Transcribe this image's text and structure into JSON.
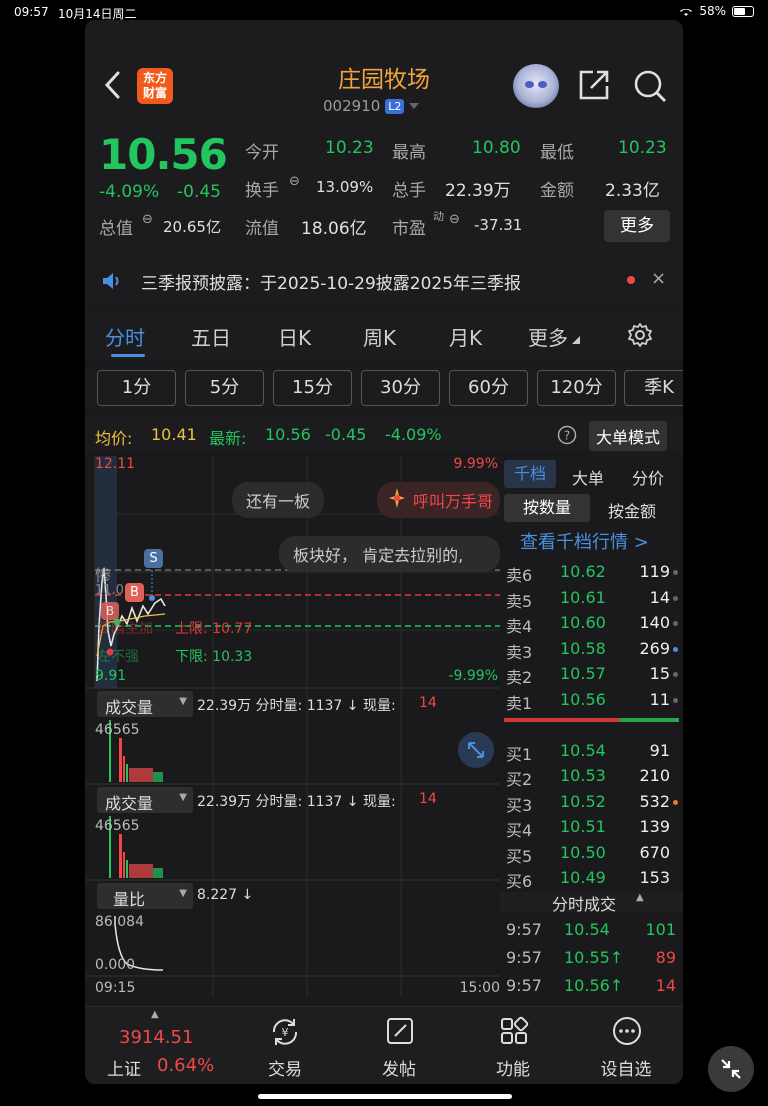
{
  "status": {
    "time": "09:57",
    "date": "10月14日周二",
    "battery": "58%"
  },
  "header": {
    "logo_text_1": "东方",
    "logo_text_2": "财富",
    "title": "庄园牧场",
    "code": "002910",
    "level_badge": "L2"
  },
  "quote": {
    "price": "10.56",
    "change_pct": "-4.09%",
    "change_abs": "-0.45",
    "open_label": "今开",
    "open": "10.23",
    "high_label": "最高",
    "high": "10.80",
    "low_label": "最低",
    "low": "10.23",
    "turnover_label": "换手",
    "turnover": "13.09%",
    "volume_label": "总手",
    "volume": "22.39万",
    "amount_label": "金额",
    "amount": "2.33亿",
    "mktcap_label": "总值",
    "mktcap": "20.65亿",
    "float_label": "流值",
    "float": "18.06亿",
    "pe_label": "市盈",
    "pe_sup": "动",
    "pe": "-37.31",
    "more_button": "更多"
  },
  "notice": {
    "text": "三季报预披露：于2025-10-29披露2025年三季报",
    "close": "×"
  },
  "tabs": [
    "分时",
    "五日",
    "日K",
    "周K",
    "月K",
    "更多"
  ],
  "intervals": [
    "1分",
    "5分",
    "15分",
    "30分",
    "60分",
    "120分",
    "季K"
  ],
  "avgbar": {
    "avg_label": "均价:",
    "avg": "10.41",
    "latest_label": "最新:",
    "latest": "10.56",
    "chg": "-0.45",
    "pct": "-4.09%",
    "mode_button": "大单模式"
  },
  "chart": {
    "upper_price": "12.11",
    "upper_pct": "9.99%",
    "lower_price": "9.91",
    "lower_pct": "-9.99%",
    "bubble1": "还有一板",
    "bubble2": "呼叫万手哥",
    "bubble3": "板块好， 肯定去拉别的,",
    "tag_left": "惨",
    "tag_s": "S",
    "tag_b": "B",
    "tag_b2": "B",
    "upper_limit": "上限: 10.77",
    "lower_limit": "下限: 10.33",
    "faded1": "要暗主加",
    "faded2": "左不强",
    "faded3": "11.0",
    "vol_label": "成交量",
    "vol_info": "22.39万 分时量: 1137 ↓ 现量:",
    "vol_now": "14",
    "vol_max": "46565",
    "ratio_label": "量比",
    "ratio_info": "8.227 ↓",
    "ratio_max": "86.084",
    "ratio_min": "0.000",
    "time_start": "09:15",
    "time_end": "15:00"
  },
  "orderbook": {
    "tabs": [
      "千档",
      "大单",
      "分价"
    ],
    "subtabs": [
      "按数量",
      "按金额"
    ],
    "link": "查看千档行情 >",
    "sells": [
      {
        "label": "卖6",
        "price": "10.62",
        "qty": "119"
      },
      {
        "label": "卖5",
        "price": "10.61",
        "qty": "14"
      },
      {
        "label": "卖4",
        "price": "10.60",
        "qty": "140"
      },
      {
        "label": "卖3",
        "price": "10.58",
        "qty": "269"
      },
      {
        "label": "卖2",
        "price": "10.57",
        "qty": "15"
      },
      {
        "label": "卖1",
        "price": "10.56",
        "qty": "11"
      }
    ],
    "buys": [
      {
        "label": "买1",
        "price": "10.54",
        "qty": "91"
      },
      {
        "label": "买2",
        "price": "10.53",
        "qty": "210"
      },
      {
        "label": "买3",
        "price": "10.52",
        "qty": "532"
      },
      {
        "label": "买4",
        "price": "10.51",
        "qty": "139"
      },
      {
        "label": "买5",
        "price": "10.50",
        "qty": "670"
      },
      {
        "label": "买6",
        "price": "10.49",
        "qty": "153"
      }
    ],
    "trades_title": "分时成交",
    "trades": [
      {
        "time": "9:57",
        "price": "10.54",
        "qty": "101"
      },
      {
        "time": "9:57",
        "price": "10.55↑",
        "qty": "89"
      },
      {
        "time": "9:57",
        "price": "10.56↑",
        "qty": "14"
      }
    ]
  },
  "nav": {
    "index_value": "3914.51",
    "index_name": "上证",
    "index_pct": "0.64%",
    "items": [
      "交易",
      "发帖",
      "功能",
      "设自选"
    ]
  },
  "colors": {
    "up": "#f04848",
    "down": "#22c55e",
    "accent": "#4a90e2",
    "brand": "#f0a43a"
  }
}
